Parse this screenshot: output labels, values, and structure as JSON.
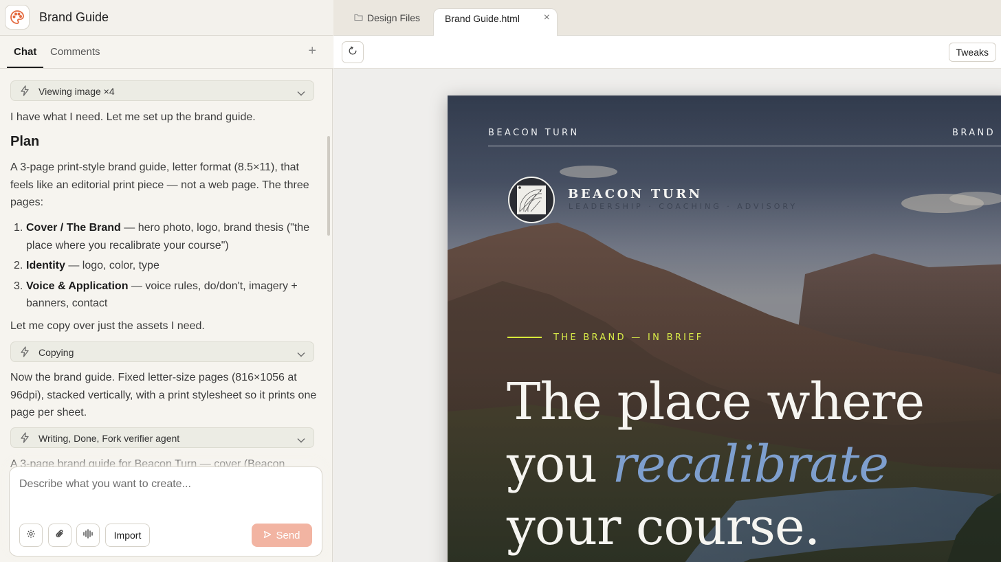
{
  "app": {
    "title": "Brand Guide",
    "icon": "palette-icon",
    "accent": "#e46a3f"
  },
  "chat_tabs": {
    "chat": "Chat",
    "comments": "Comments",
    "add": "+"
  },
  "chat": {
    "pill_viewing": "Viewing image ×4",
    "msg_intro": "I have what I need. Let me set up the brand guide.",
    "plan_heading": "Plan",
    "plan_desc": "A 3-page print-style brand guide, letter format (8.5×11), that feels like an editorial print piece — not a web page. The three pages:",
    "plan_items": [
      {
        "num": "1.",
        "title": "Cover / The Brand",
        "desc": " — hero photo, logo, brand thesis (\"the place where you recalibrate your course\")"
      },
      {
        "num": "2.",
        "title": "Identity",
        "desc": " — logo, color, type"
      },
      {
        "num": "3.",
        "title": "Voice & Application",
        "desc": " — voice rules, do/don't, imagery + banners, contact"
      }
    ],
    "msg_copy": "Let me copy over just the assets I need.",
    "pill_copying": "Copying",
    "msg_pages": "Now the brand guide. Fixed letter-size pages (816×1056 at 96dpi), stacked vertically, with a print stylesheet so it prints one page per sheet.",
    "pill_writing": "Writing, Done, Fork verifier agent",
    "msg_summary": "A 3-page brand guide for Beacon Turn — cover (Beacon"
  },
  "composer": {
    "placeholder": "Describe what you want to create...",
    "import_label": "Import",
    "send_label": "Send",
    "send_color": "#f2b4a2"
  },
  "file_tabs": {
    "design_files": "Design Files",
    "active_file": "Brand Guide.html",
    "close": "×"
  },
  "toolbar": {
    "tweaks_label": "Tweaks"
  },
  "preview": {
    "brand_top": "BEACON TURN",
    "brand_right": "BRAND",
    "logo_title": "BEACON TURN",
    "logo_subtitle": "LEADERSHIP · COACHING · ADVISORY",
    "eyebrow": "THE BRAND — IN BRIEF",
    "headline_line1": "The place where",
    "headline_line2_pre": "you ",
    "headline_line2_accent": "recalibrate",
    "headline_line3": "your course.",
    "eyebrow_color": "#d9ec48",
    "accent_color": "#7e9fce"
  }
}
